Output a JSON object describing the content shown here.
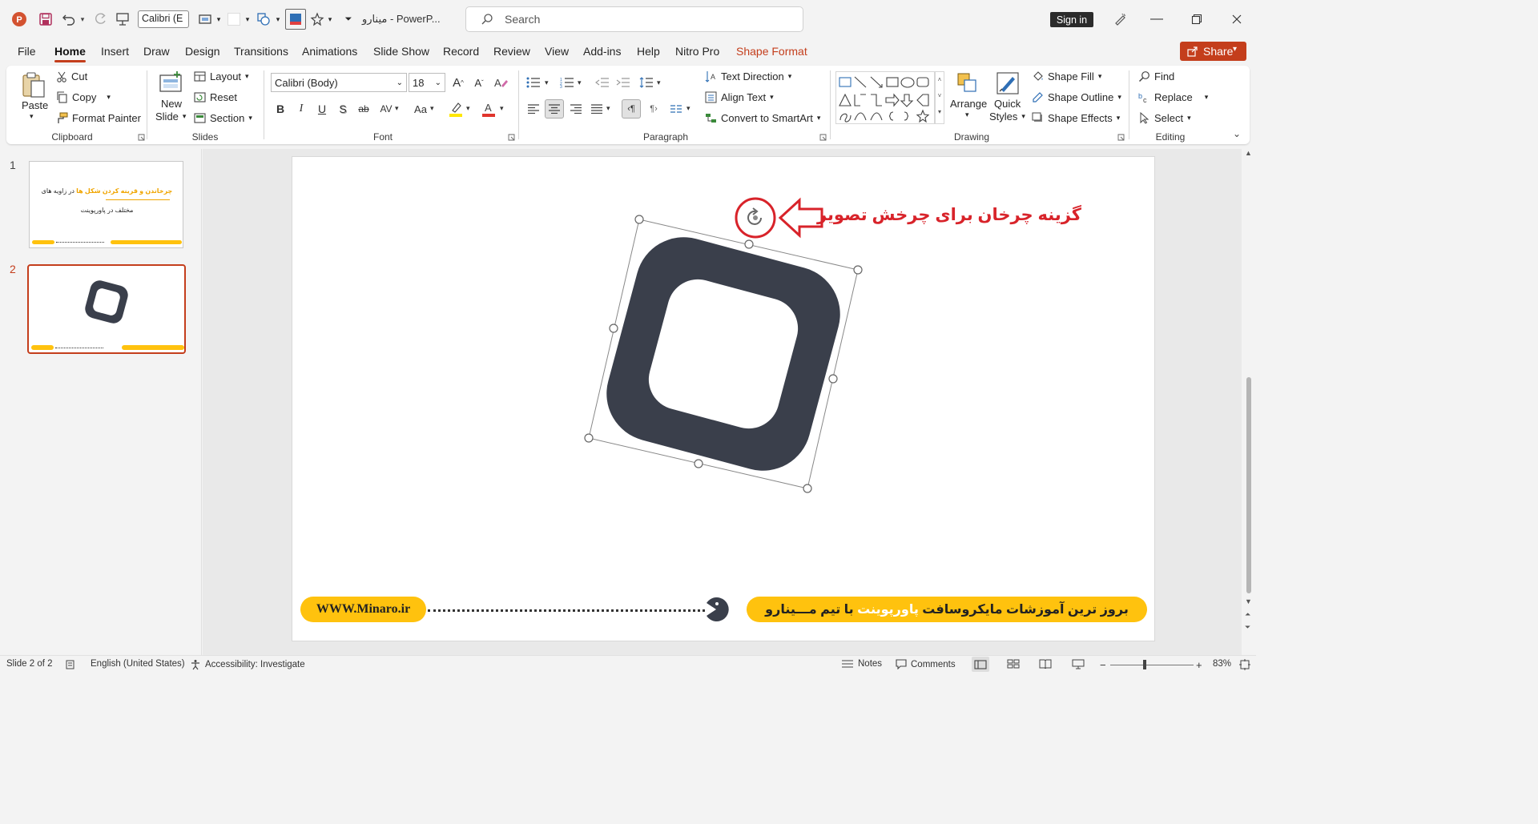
{
  "titlebar": {
    "font_combo": "Calibri (E",
    "doc_title": "مینارو - PowerP...",
    "search_placeholder": "Search",
    "signin_label": "Sign in"
  },
  "tabs": [
    "File",
    "Home",
    "Insert",
    "Draw",
    "Design",
    "Transitions",
    "Animations",
    "Slide Show",
    "Record",
    "Review",
    "View",
    "Add-ins",
    "Help",
    "Nitro Pro",
    "Shape Format"
  ],
  "share_label": "Share",
  "ribbon": {
    "clipboard": {
      "paste": "Paste",
      "cut": "Cut",
      "copy": "Copy",
      "format_painter": "Format Painter",
      "label": "Clipboard"
    },
    "slides": {
      "new_slide_1": "New",
      "new_slide_2": "Slide",
      "layout": "Layout",
      "reset": "Reset",
      "section": "Section",
      "label": "Slides"
    },
    "font": {
      "font_name": "Calibri (Body)",
      "font_size": "18",
      "label": "Font",
      "bold": "B",
      "italic": "I",
      "underline": "U",
      "shadow": "S",
      "strike": "ab",
      "spacing": "AV",
      "case": "Aa"
    },
    "paragraph": {
      "text_direction": "Text Direction",
      "align_text": "Align Text",
      "convert_smartart": "Convert to SmartArt",
      "label": "Paragraph"
    },
    "drawing": {
      "arrange": "Arrange",
      "quick_styles_1": "Quick",
      "quick_styles_2": "Styles",
      "shape_fill": "Shape Fill",
      "shape_outline": "Shape Outline",
      "shape_effects": "Shape Effects",
      "label": "Drawing"
    },
    "editing": {
      "find": "Find",
      "replace": "Replace",
      "select": "Select",
      "label": "Editing"
    }
  },
  "thumbnails": [
    {
      "number": "1",
      "title_yellow": "چرخاندن و قرینه کردن شکل ها",
      "title_black": "در زاویه های",
      "subtitle": "مختلف در پاورپوینت"
    },
    {
      "number": "2"
    }
  ],
  "slide": {
    "annotation": "گزینه چرخان برای چرخش تصویر",
    "footer_left": "WWW.Minaro.ir",
    "footer_right_part1": "بروز ترین آموزشات مایکروسافت",
    "footer_right_highlight": "پاورپوینت",
    "footer_right_part2": "با تیم مـــینارو"
  },
  "colors": {
    "accent": "#c43e1c",
    "yellow": "#ffc20e",
    "shape": "#3a3f4b",
    "annotation": "#d8232a"
  },
  "status": {
    "slide_info": "Slide 2 of 2",
    "language": "English (United States)",
    "accessibility": "Accessibility: Investigate",
    "notes": "Notes",
    "comments": "Comments",
    "zoom": "83%"
  }
}
